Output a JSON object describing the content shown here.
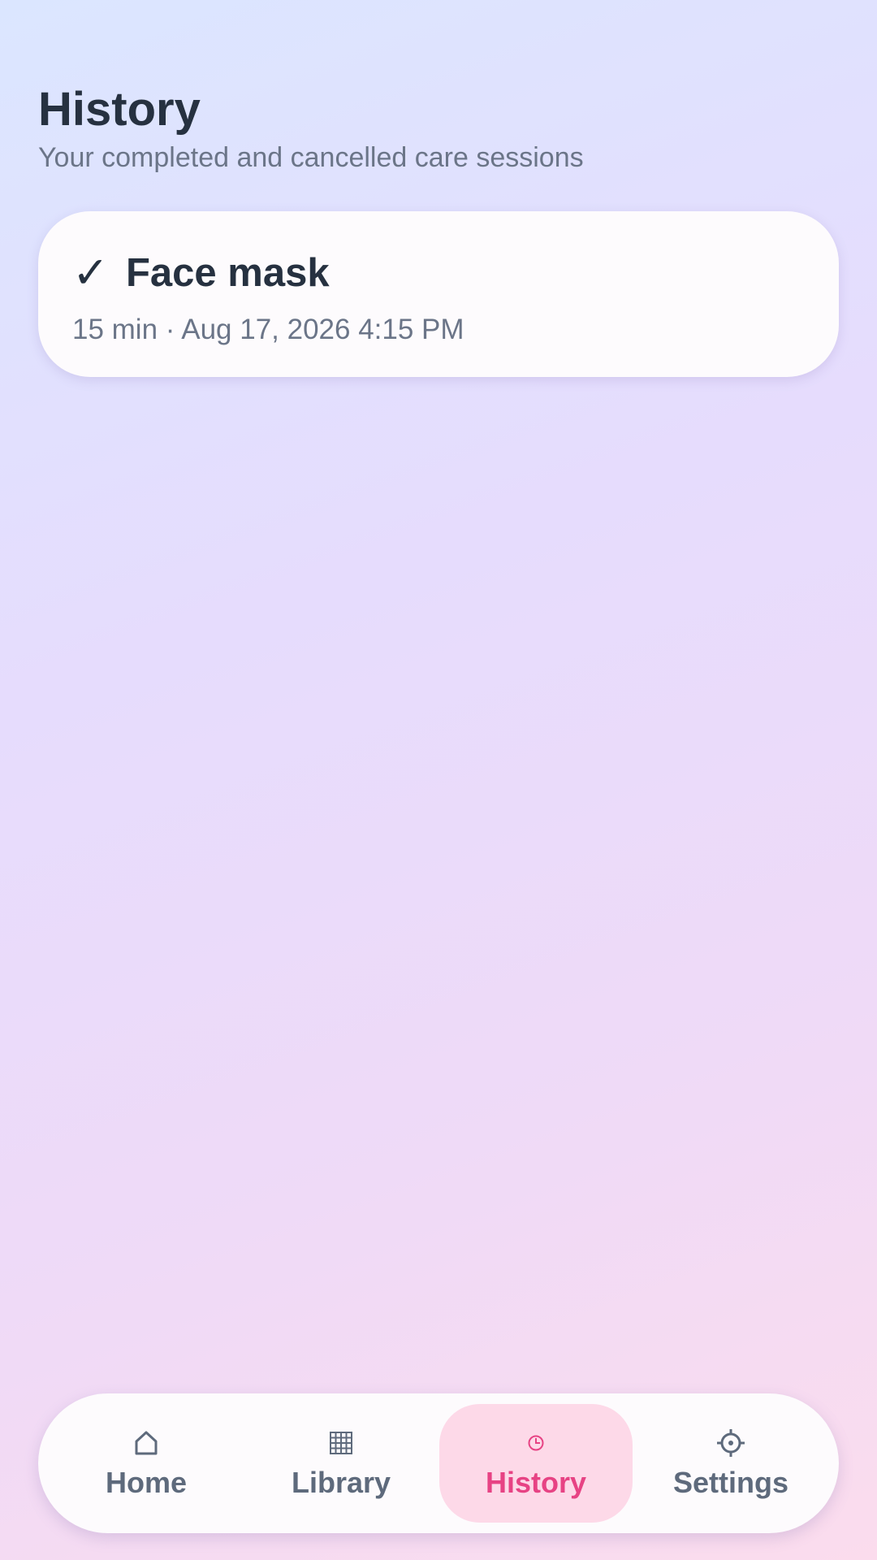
{
  "header": {
    "title": "History",
    "subtitle": "Your completed and cancelled care sessions"
  },
  "history": {
    "items": [
      {
        "status_icon": "check-icon",
        "title": "Face mask",
        "meta": "15 min · Aug 17, 2026 4:15 PM"
      }
    ]
  },
  "nav": {
    "items": [
      {
        "icon": "home-icon",
        "label": "Home",
        "active": false
      },
      {
        "icon": "library-grid-icon",
        "label": "Library",
        "active": false
      },
      {
        "icon": "history-clock-icon",
        "label": "History",
        "active": true
      },
      {
        "icon": "settings-gear-icon",
        "label": "Settings",
        "active": false
      }
    ]
  },
  "colors": {
    "accent": "#e74384",
    "active_tab_bg": "#fdd9e8",
    "text_primary": "#263140",
    "text_secondary": "#6b7588",
    "card_bg": "#fdfbfd"
  }
}
